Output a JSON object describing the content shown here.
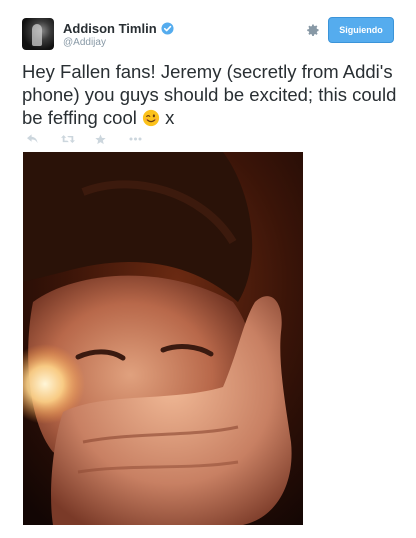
{
  "user": {
    "display_name": "Addison Timlin",
    "handle": "@Addijay",
    "verified": true
  },
  "follow_button": {
    "label": "Siguiendo"
  },
  "tweet": {
    "text": "Hey Fallen fans! Jeremy (secretly from Addi's phone) you guys should be excited; this could be feffing cool",
    "suffix": "x"
  },
  "icons": {
    "verified": "verified-badge-icon",
    "settings": "gear-icon",
    "reply": "reply-icon",
    "retweet": "retweet-icon",
    "favorite": "star-icon",
    "more": "more-icon",
    "emoji": "winking-face-emoji"
  },
  "colors": {
    "accent": "#55acee",
    "text": "#292f33",
    "muted": "#8899a6",
    "action_icon": "#ccd6dd"
  }
}
